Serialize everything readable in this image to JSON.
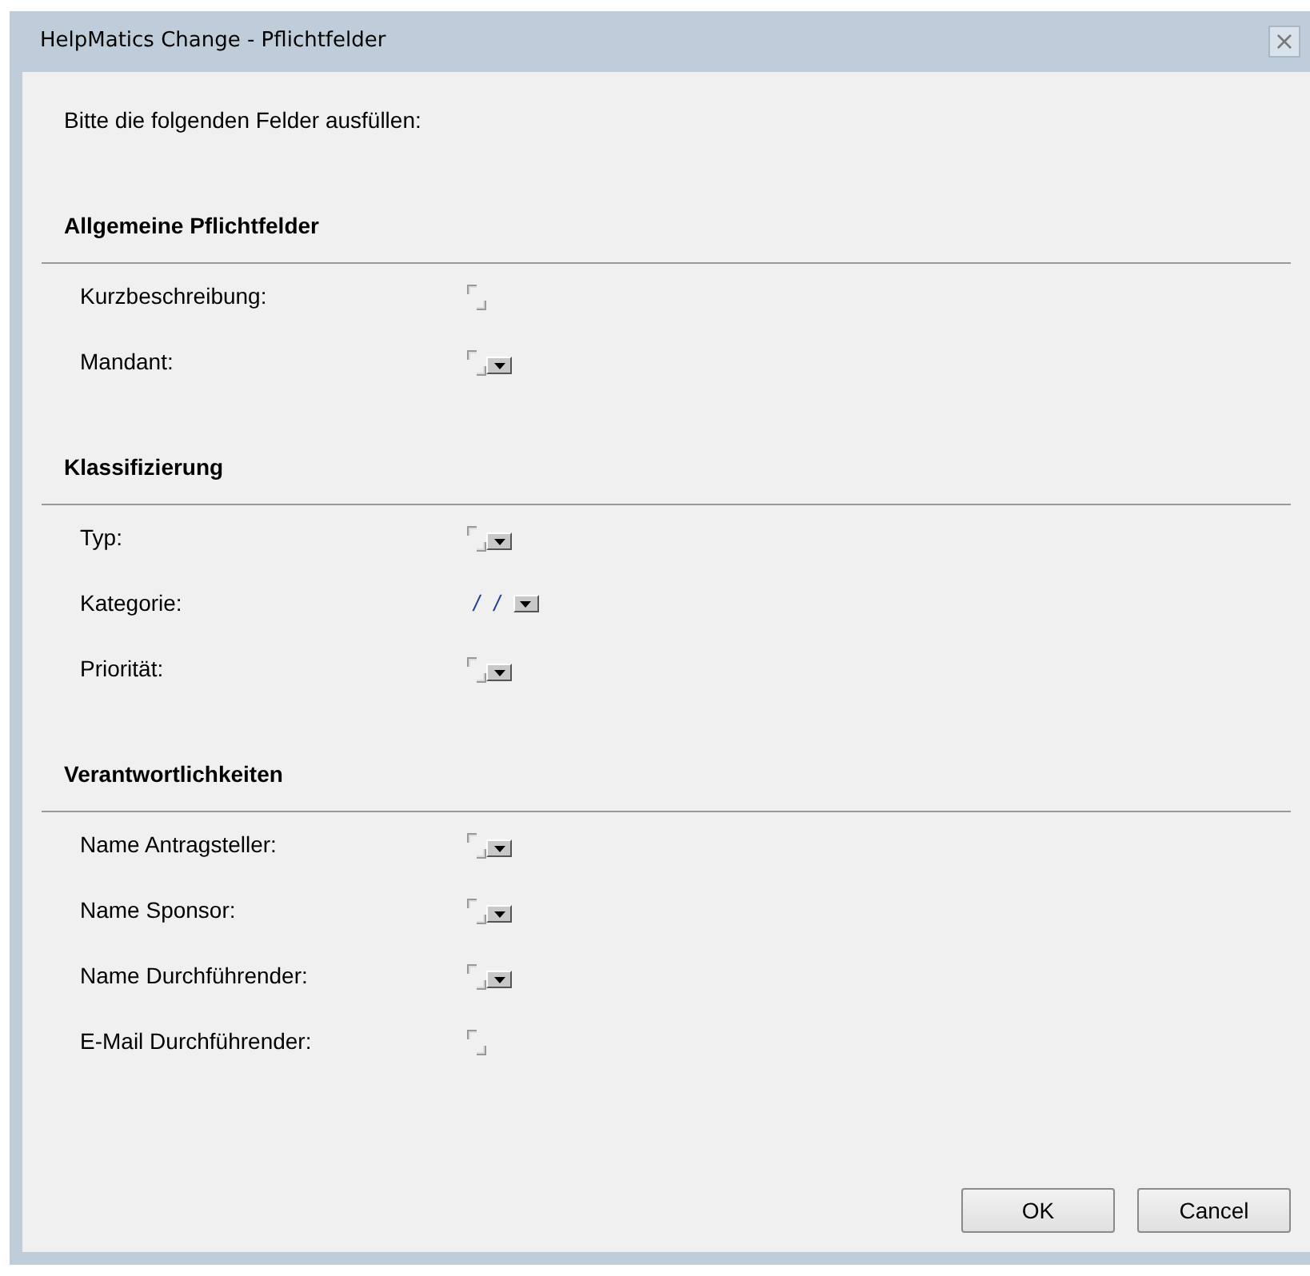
{
  "window": {
    "title": "HelpMatics Change - Pflichtfelder",
    "close": "×"
  },
  "intro": "Bitte die folgenden Felder ausfüllen:",
  "sections": [
    {
      "heading": "Allgemeine Pflichtfelder",
      "fields": [
        {
          "label": "Kurzbeschreibung:",
          "kind": "text"
        },
        {
          "label": "Mandant:",
          "kind": "select"
        }
      ]
    },
    {
      "heading": "Klassifizierung",
      "fields": [
        {
          "label": "Typ:",
          "kind": "select"
        },
        {
          "label": "Kategorie:",
          "kind": "date",
          "value": "/ /"
        },
        {
          "label": "Priorität:",
          "kind": "select"
        }
      ]
    },
    {
      "heading": "Verantwortlichkeiten",
      "fields": [
        {
          "label": "Name Antragsteller:",
          "kind": "select"
        },
        {
          "label": "Name Sponsor:",
          "kind": "select"
        },
        {
          "label": "Name Durchführender:",
          "kind": "select"
        },
        {
          "label": "E-Mail Durchführender:",
          "kind": "text"
        }
      ]
    }
  ],
  "buttons": [
    "OK",
    "Cancel"
  ]
}
